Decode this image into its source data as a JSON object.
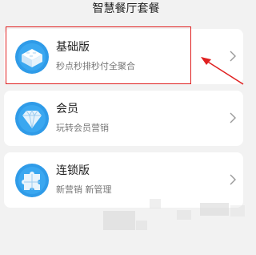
{
  "page": {
    "title": "智慧餐厅套餐"
  },
  "plans": [
    {
      "name": "基础版",
      "desc": "秒点秒排秒付全聚合",
      "icon": "cube-icon"
    },
    {
      "name": "会员",
      "desc": "玩转会员营销",
      "icon": "diamond-icon"
    },
    {
      "name": "连锁版",
      "desc": "新营销 新管理",
      "icon": "puzzle-icon"
    }
  ],
  "annotation": {
    "highlight_color": "#e02020"
  },
  "colors": {
    "icon_blue": "#2f9be8",
    "background": "#f2f2f2"
  }
}
